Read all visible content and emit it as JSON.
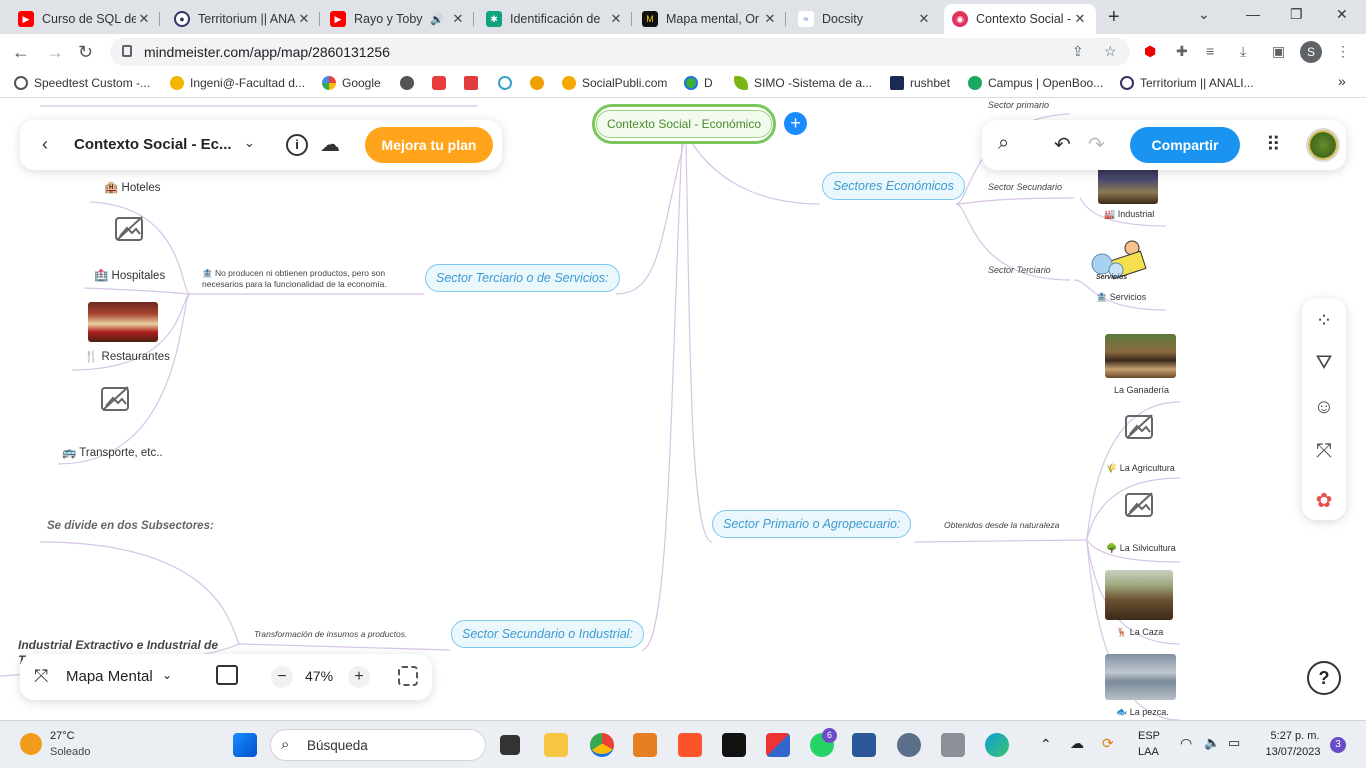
{
  "browser": {
    "tabs": [
      {
        "title": "Curso de SQL des",
        "icon_color": "#ff0000"
      },
      {
        "title": "Territorium || ANA",
        "icon_color": "#333366"
      },
      {
        "title": "Rayo y Toby -",
        "icon_color": "#ff0000"
      },
      {
        "title": "Identificación de",
        "icon_color": "#10a37f"
      },
      {
        "title": "Mapa mental, Or",
        "icon_color": "#ffcc00"
      },
      {
        "title": "Docsity",
        "icon_color": "#2a7bd6"
      },
      {
        "title": "Contexto Social -",
        "icon_color": "#e3325c"
      }
    ],
    "close_glyph": "✕",
    "new_tab": "+",
    "url": "mindmeister.com/app/map/2860131256",
    "bookmarks": [
      {
        "label": "Speedtest Custom -...",
        "color": "#555555"
      },
      {
        "label": "Ingeni@-Facultad d...",
        "color": "#f2b500"
      },
      {
        "label": "Google",
        "color": "#4285f4"
      },
      {
        "label": "",
        "color": "#555555"
      },
      {
        "label": "",
        "color": "#e83b3b"
      },
      {
        "label": "",
        "color": "#e33e3e"
      },
      {
        "label": "",
        "color": "#3aa0c8"
      },
      {
        "label": "",
        "color": "#f0a000"
      },
      {
        "label": "SocialPubli.com",
        "color": "#f6a700"
      },
      {
        "label": "D",
        "color": "#3cb034"
      },
      {
        "label": "SIMO -Sistema de a...",
        "color": "#7cb518"
      },
      {
        "label": "rushbet",
        "color": "#1b2a55"
      },
      {
        "label": "Campus | OpenBoo...",
        "color": "#1aa863"
      },
      {
        "label": "Territorium || ANALI...",
        "color": "#333366"
      }
    ],
    "more": "»",
    "profile": "S"
  },
  "app": {
    "map_title": "Contexto Social - Ec...",
    "upgrade_label": "Mejora tu plan",
    "share_label": "Compartir",
    "mode_label": "Mapa Mental",
    "zoom": "47%",
    "zoom_minus": "−",
    "zoom_plus": "+",
    "help": "?"
  },
  "map": {
    "root": "Contexto Social - Económico",
    "nodes": {
      "sectores": "Sectores Económicos",
      "terciario": "Sector Terciario o de Servicios:",
      "primario": "Sector Primario o Agropecuario:",
      "secundario": "Sector Secundario o Industrial:"
    },
    "labels": {
      "sector_primario": "Sector primario",
      "sector_secundario": "Sector Secundario",
      "sector_terciario": "Sector Terciario",
      "industrial": "🏭 Industrial",
      "servicios": "🏦 Servicios",
      "servicios_art": "Servicios",
      "terciario_desc_1": "🏦 No producen ni obtienen productos, pero son",
      "terciario_desc_2": "necesarios para la funcionalidad de la economía.",
      "primario_desc": "Obtenidos desde la naturaleza",
      "secundario_desc": "Transformación de insumos a productos.",
      "subsectores": "Se divide en dos Subsectores:",
      "extractivo": "Industrial Extractivo e Industrial de",
      "extractivo_cut": "Tr"
    },
    "left_items": {
      "hoteles": "🏨 Hoteles",
      "hospitales": "🏥 Hospitales",
      "restaurantes": "🍴 Restaurantes",
      "transporte": "🚌 Transporte, etc.."
    },
    "right_items": {
      "ganaderia": "La Ganadería",
      "agricultura": "🌾 La Agricultura",
      "silvicultura": "🌳 La Silvicultura",
      "caza": "🦌 La Caza",
      "pezca": "🐟 La pezca."
    }
  },
  "taskbar": {
    "weather_temp": "27°C",
    "weather_desc": "Soleado",
    "search_placeholder": "Búsqueda",
    "whatsapp_badge": "6",
    "lang_1": "ESP",
    "lang_2": "LAA",
    "time": "5:27 p. m.",
    "date": "13/07/2023",
    "notif": "3"
  }
}
